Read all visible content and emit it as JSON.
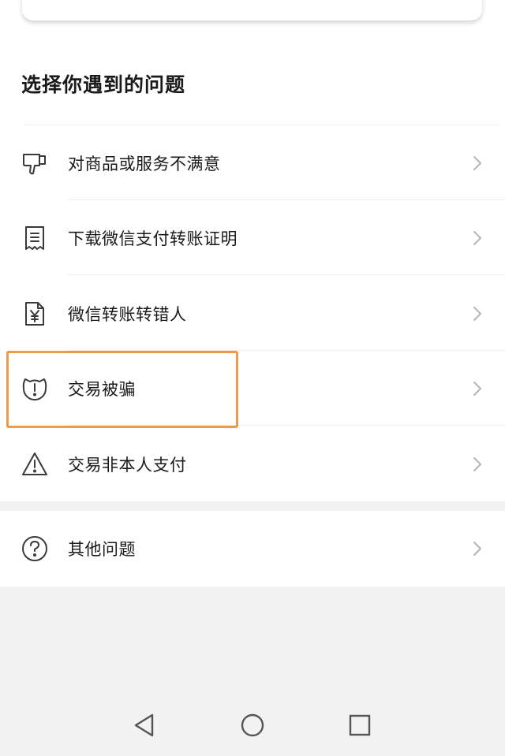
{
  "section_title": "选择你遇到的问题",
  "items": [
    {
      "label": "对商品或服务不满意",
      "icon": "thumbs-down-icon"
    },
    {
      "label": "下载微信支付转账证明",
      "icon": "receipt-icon"
    },
    {
      "label": "微信转账转错人",
      "icon": "yuan-document-icon"
    },
    {
      "label": "交易被骗",
      "icon": "alert-shield-icon"
    },
    {
      "label": "交易非本人支付",
      "icon": "warning-triangle-icon"
    }
  ],
  "other_item": {
    "label": "其他问题",
    "icon": "question-circle-icon"
  },
  "nav": {
    "back": "back-triangle-icon",
    "home": "home-circle-icon",
    "recents": "recents-square-icon"
  },
  "colors": {
    "highlight": "#ee9a4c",
    "text": "#1a1a1a",
    "icon": "#3a3a3a",
    "chevron": "#b5b5b5",
    "background": "#f2f2f2"
  }
}
